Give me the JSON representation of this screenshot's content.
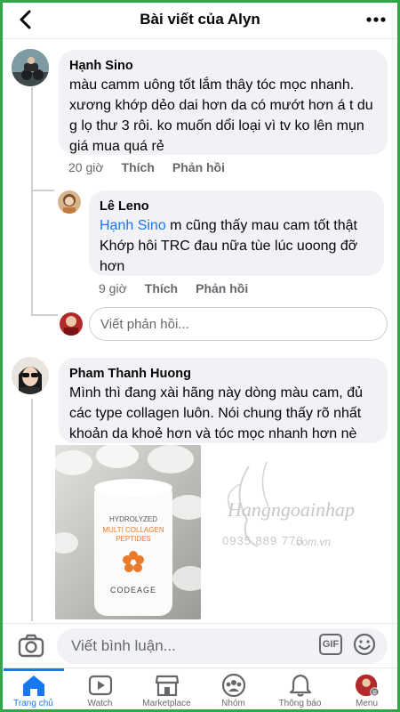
{
  "header": {
    "title": "Bài viết của Alyn"
  },
  "comments": [
    {
      "author": "Hạnh Sino",
      "text": "màu camm uông tốt lắm thây tóc mọc nhanh.\nxương khớp dẻo dai hơn da có mướt hơn á t du\ng lọ thư 3 rôi. ko muốn dổi loại vì tv ko lên mụn\ngiá mua quá rẻ",
      "time": "20 giờ",
      "like_label": "Thích",
      "reply_label": "Phản hồi",
      "replies": [
        {
          "author": "Lê Leno",
          "mention": "Hạnh Sino",
          "text_line1_rest": " m cũng thấy mau cam tốt thật",
          "text_rest": "Khớp hôi TRC đau nữa tùe lúc uoong đỡ\nhơn",
          "time": "9 giờ",
          "like_label": "Thích",
          "reply_label": "Phản hồi"
        }
      ],
      "reply_placeholder": "Viết phản hồi..."
    },
    {
      "author": "Pham Thanh Huong",
      "text": "Mình thì đang xài hãng này dòng màu cam, đủ\ncác type collagen luôn. Nói chung thấy rõ nhất\nkhoản da khoẻ hơn và tóc mọc nhanh hơn nè",
      "photo": {
        "label_top": "HYDROLYZED",
        "label_main": "MULTI COLLAGEN\nPEPTIDES",
        "label_brand": "CODEAGE"
      }
    }
  ],
  "watermark": {
    "text": "Hangngoainhap",
    "sub": ".com.vn",
    "phone": "0935 889 770"
  },
  "composer": {
    "placeholder": "Viết bình luận...",
    "gif_label": "GIF"
  },
  "bottom_nav": [
    {
      "label": "Trang chủ",
      "icon": "home-icon",
      "active": true
    },
    {
      "label": "Watch",
      "icon": "watch-icon",
      "active": false
    },
    {
      "label": "Marketplace",
      "icon": "marketplace-icon",
      "active": false
    },
    {
      "label": "Nhóm",
      "icon": "groups-icon",
      "active": false
    },
    {
      "label": "Thông báo",
      "icon": "bell-icon",
      "active": false
    },
    {
      "label": "Menu",
      "icon": "menu-avatar-icon",
      "active": false
    }
  ],
  "colors": {
    "accent": "#1877f2",
    "bubble": "#f0f2f5",
    "secondary_text": "#65676b",
    "frame": "#2fa84a"
  }
}
